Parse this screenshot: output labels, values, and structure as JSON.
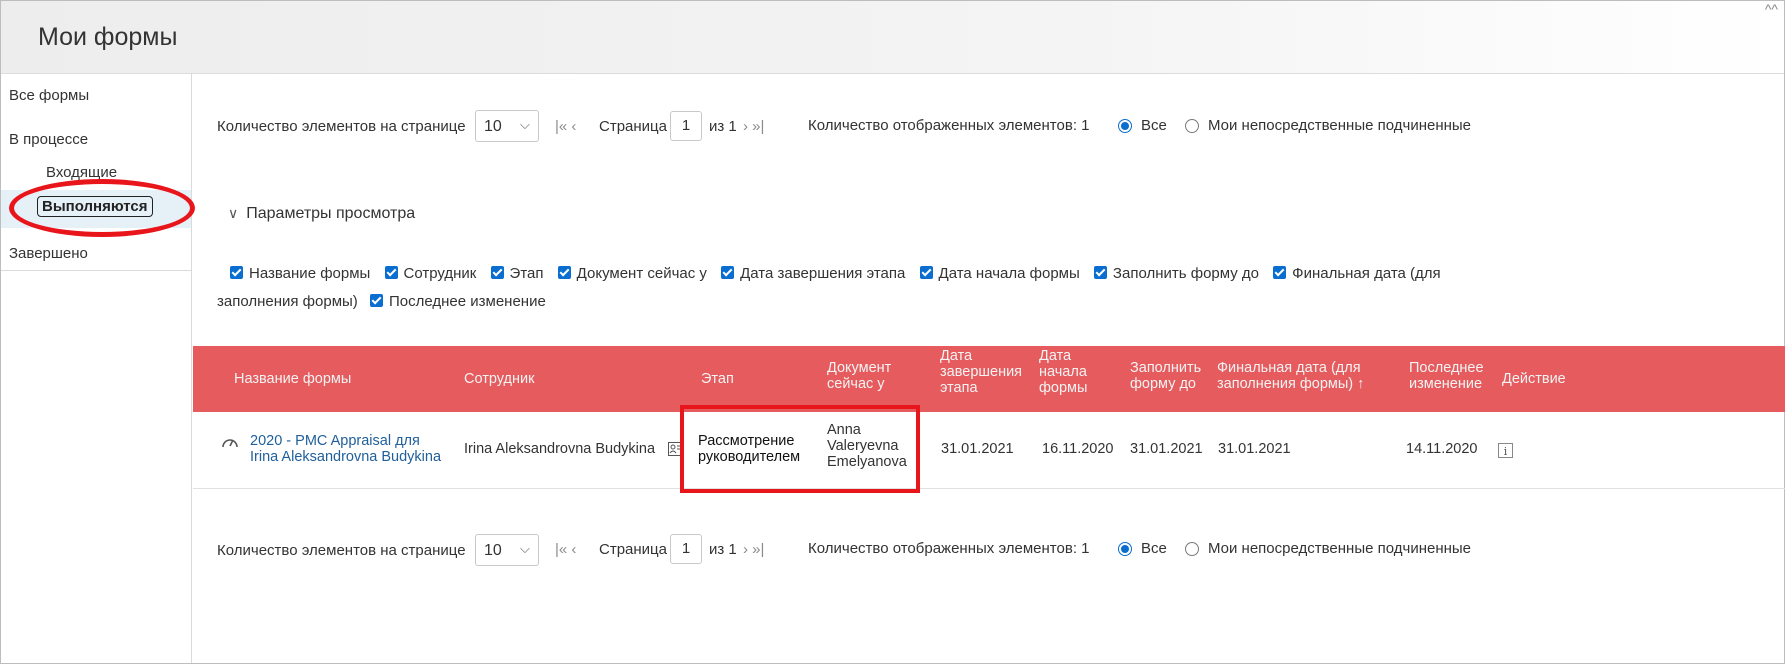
{
  "header": {
    "title": "Мои формы",
    "corner": "^^"
  },
  "sidebar": {
    "items": [
      {
        "label": "Все формы"
      },
      {
        "label": "В процессе"
      },
      {
        "label": "Входящие"
      },
      {
        "label": "Выполняются"
      },
      {
        "label": "Завершено"
      }
    ]
  },
  "pager": {
    "items_per_page_label": "Количество элементов на странице",
    "items_per_page_value": "10",
    "first_prev": "|« ‹",
    "page_label": "Страница",
    "page_value": "1",
    "of_label": "из 1",
    "next_last": "› »|",
    "displayed_label": "Количество отображенных элементов: 1",
    "filter_all": "Все",
    "filter_direct": "Мои непосредственные подчиненные"
  },
  "view_params": {
    "label": "Параметры просмотра"
  },
  "columns_options": [
    "Название формы",
    "Сотрудник",
    "Этап",
    "Документ сейчас у",
    "Дата завершения этапа",
    "Дата начала формы",
    "Заполнить форму до",
    "Финальная дата (для",
    "заполнения формы)",
    "Последнее изменение"
  ],
  "table": {
    "headers": {
      "form_name": "Название формы",
      "employee": "Сотрудник",
      "stage": "Этап",
      "doc_1": "Документ",
      "doc_2": "сейчас у",
      "stage_end_1": "Дата",
      "stage_end_2": "завершения",
      "stage_end_3": "этапа",
      "start_1": "Дата",
      "start_2": "начала",
      "start_3": "формы",
      "fill_1": "Заполнить",
      "fill_2": "форму до",
      "final_1": "Финальная дата (для",
      "final_2": "заполнения формы) ↑",
      "last_1": "Последнее",
      "last_2": "изменение",
      "actions": "Действие"
    },
    "row": {
      "form_name_1": "2020 - PMC Appraisal для",
      "form_name_2": "Irina Aleksandrovna Budykina",
      "employee": "Irina Aleksandrovna Budykina",
      "stage_1": "Рассмотрение",
      "stage_2": "руководителем",
      "doc_1": "Anna",
      "doc_2": "Valeryevna",
      "doc_3": "Emelyanova",
      "stage_end": "31.01.2021",
      "start": "16.11.2020",
      "fill_by": "31.01.2021",
      "final": "31.01.2021",
      "last_change": "14.11.2020",
      "info": "i"
    }
  },
  "colors": {
    "accent": "#0a6ed1",
    "header_row": "#e65b5e",
    "annotation": "#e8151b",
    "link": "#1f5f9b"
  }
}
